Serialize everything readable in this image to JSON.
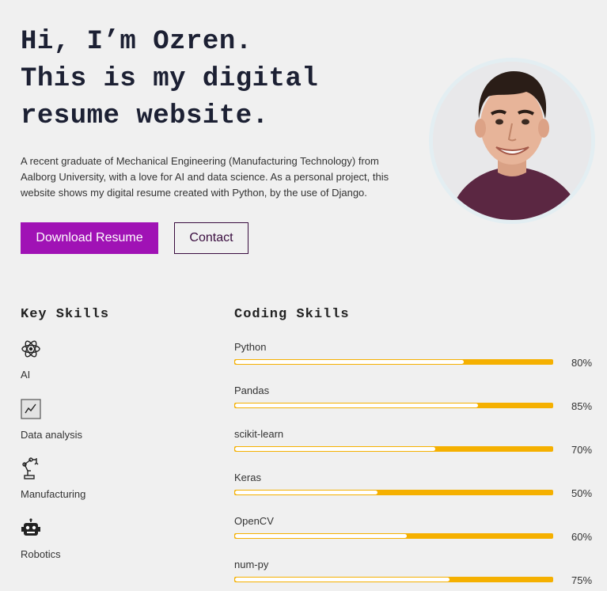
{
  "hero": {
    "line1": "Hi, I’m Ozren.",
    "line2": "This is my digital",
    "line3": "resume website.",
    "intro": "A recent graduate of Mechanical Engineering (Manufacturing Technology) from Aalborg University, with a love for AI and data science. As a personal project, this website shows my digital resume created with Python, by the use of Django."
  },
  "buttons": {
    "download": "Download Resume",
    "contact": "Contact"
  },
  "colors": {
    "primary": "#a012b5",
    "bar": "#f5b000",
    "title": "#1c2033"
  },
  "key_skills": {
    "title": "Key Skills",
    "items": [
      {
        "label": "AI",
        "icon": "atom-icon"
      },
      {
        "label": "Data analysis",
        "icon": "chart-icon"
      },
      {
        "label": "Manufacturing",
        "icon": "robot-arm-icon"
      },
      {
        "label": "Robotics",
        "icon": "robot-head-icon"
      }
    ]
  },
  "coding_skills": {
    "title": "Coding Skills",
    "items": [
      {
        "name": "Python",
        "percent": 80,
        "percent_label": "80%"
      },
      {
        "name": "Pandas",
        "percent": 85,
        "percent_label": "85%"
      },
      {
        "name": "scikit-learn",
        "percent": 70,
        "percent_label": "70%"
      },
      {
        "name": "Keras",
        "percent": 50,
        "percent_label": "50%"
      },
      {
        "name": "OpenCV",
        "percent": 60,
        "percent_label": "60%"
      },
      {
        "name": "num-py",
        "percent": 75,
        "percent_label": "75%"
      }
    ]
  }
}
